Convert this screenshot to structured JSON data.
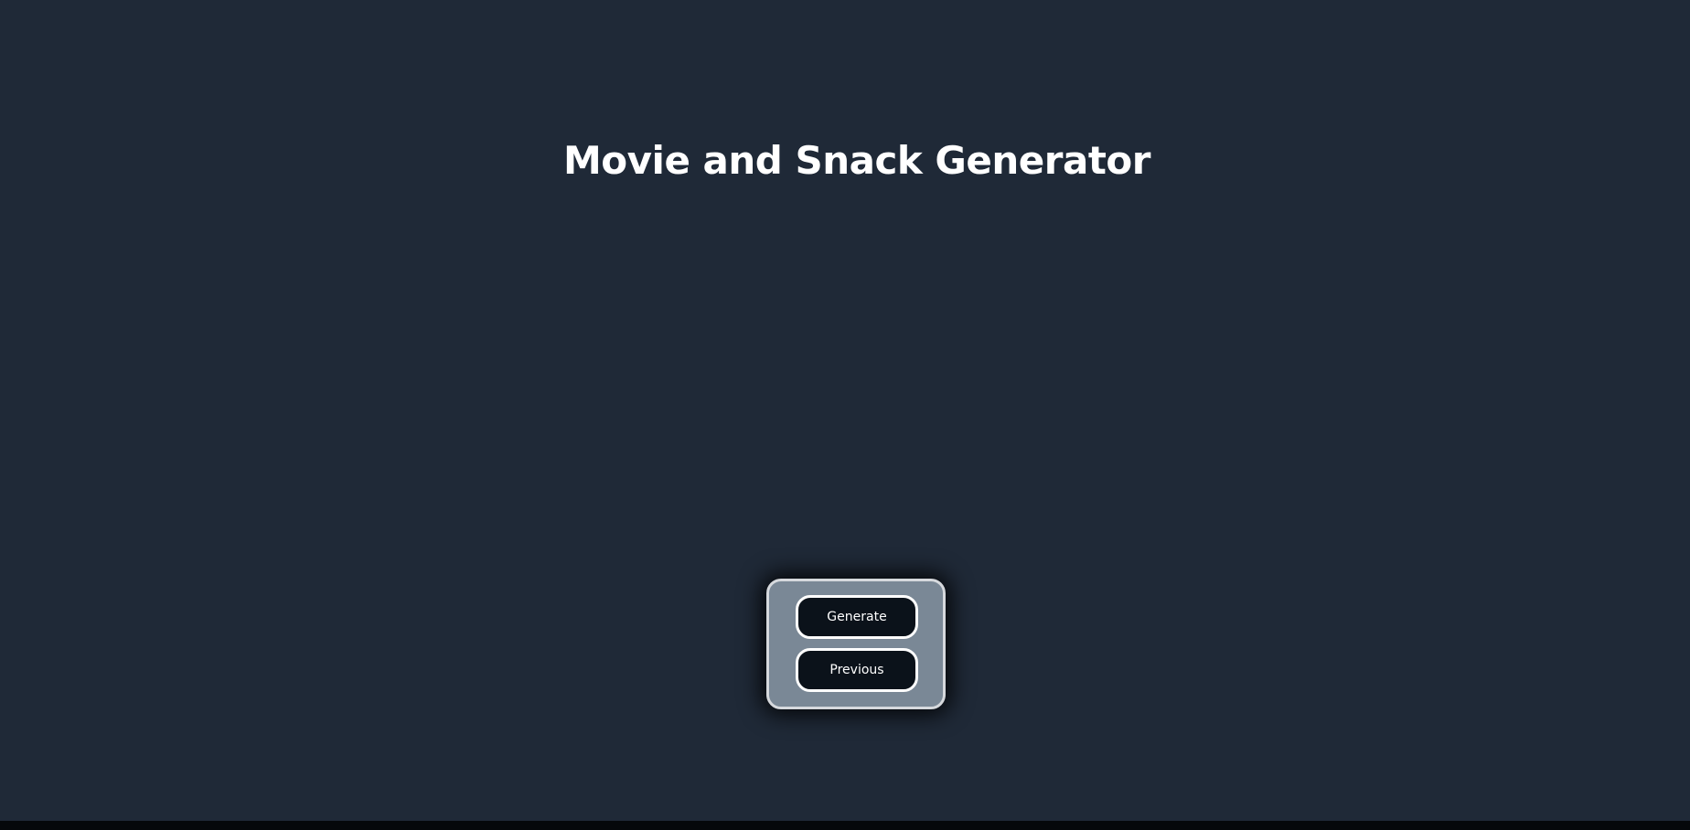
{
  "page": {
    "title": "Movie and Snack Generator"
  },
  "controls": {
    "generate_label": "Generate",
    "previous_label": "Previous"
  },
  "colors": {
    "background": "#1f2937",
    "panel": "#7a8896",
    "button": "#0b121a",
    "text": "#ffffff"
  }
}
